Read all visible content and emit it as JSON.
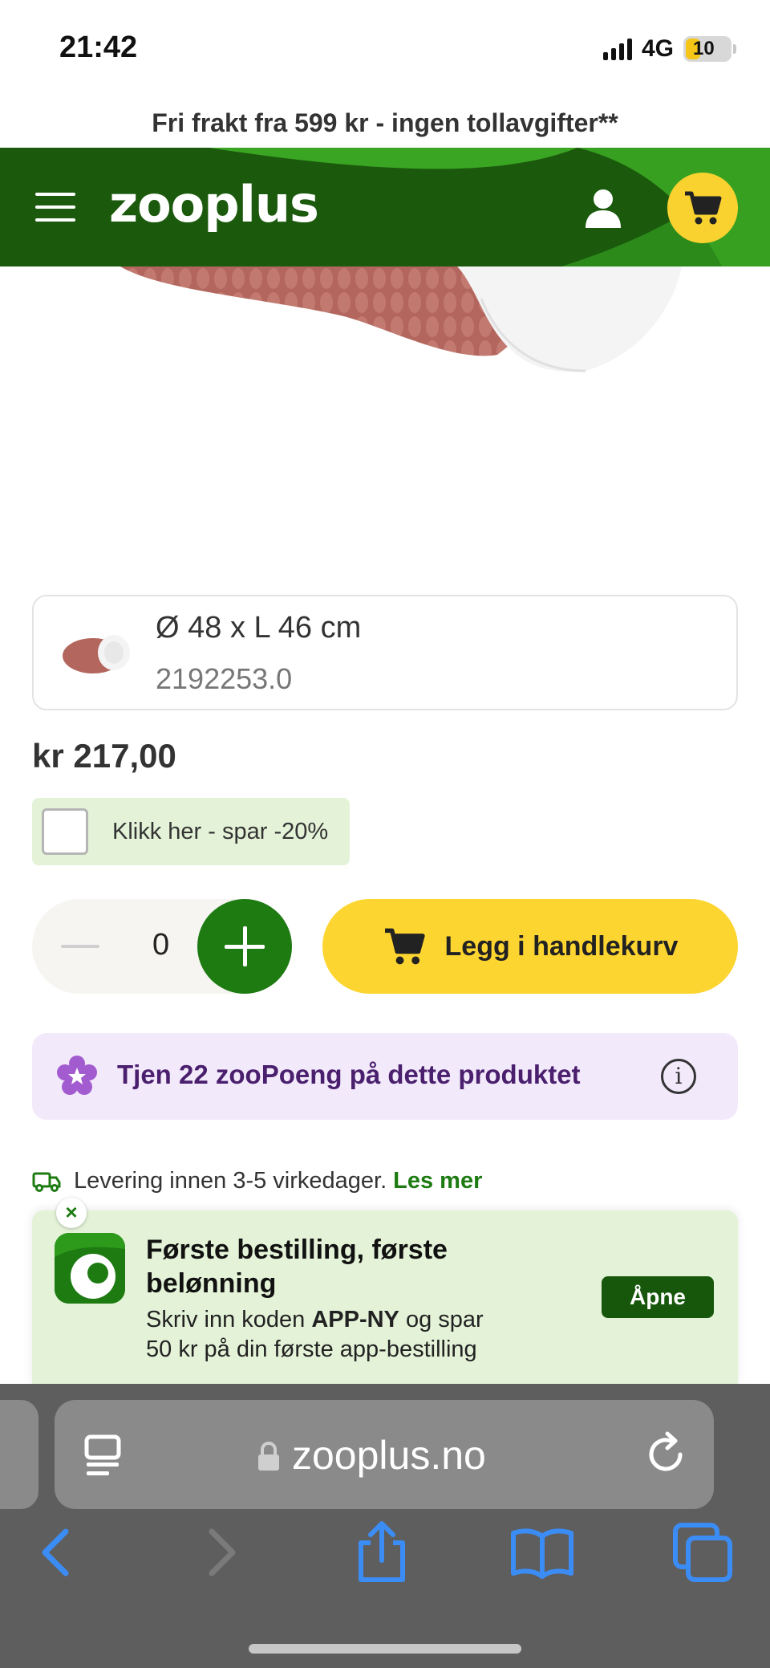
{
  "status_bar": {
    "time": "21:42",
    "network": "4G",
    "battery_level": "10"
  },
  "promo": {
    "text": "Fri frakt fra 599 kr - ingen tollavgifter**"
  },
  "header": {
    "logo": "zooplus",
    "menu_icon": "hamburger-icon",
    "user_icon": "user-icon",
    "cart_icon": "cart-icon",
    "colors": {
      "green": "#1b5a0d",
      "yellow": "#f9d230"
    }
  },
  "variant": {
    "size": "Ø 48 x L 46 cm",
    "sku": "2192253.0"
  },
  "price": "kr 217,00",
  "save_option": {
    "label": "Klikk her - spar -20%",
    "checked": false
  },
  "quantity": {
    "value": "0"
  },
  "add_to_cart": {
    "label": "Legg i handlekurv"
  },
  "points": {
    "text": "Tjen 22 zooPoeng på dette produktet"
  },
  "delivery": {
    "text": "Levering innen 3-5 virkedager.",
    "link": "Les mer"
  },
  "app_banner": {
    "close": "×",
    "title": "Første bestilling, første belønning",
    "body_pre": "Skriv inn koden ",
    "code": "APP-NY",
    "body_post": " og spar 50 kr på din første app-bestilling",
    "button": "Åpne"
  },
  "browser": {
    "url": "zooplus.no"
  }
}
